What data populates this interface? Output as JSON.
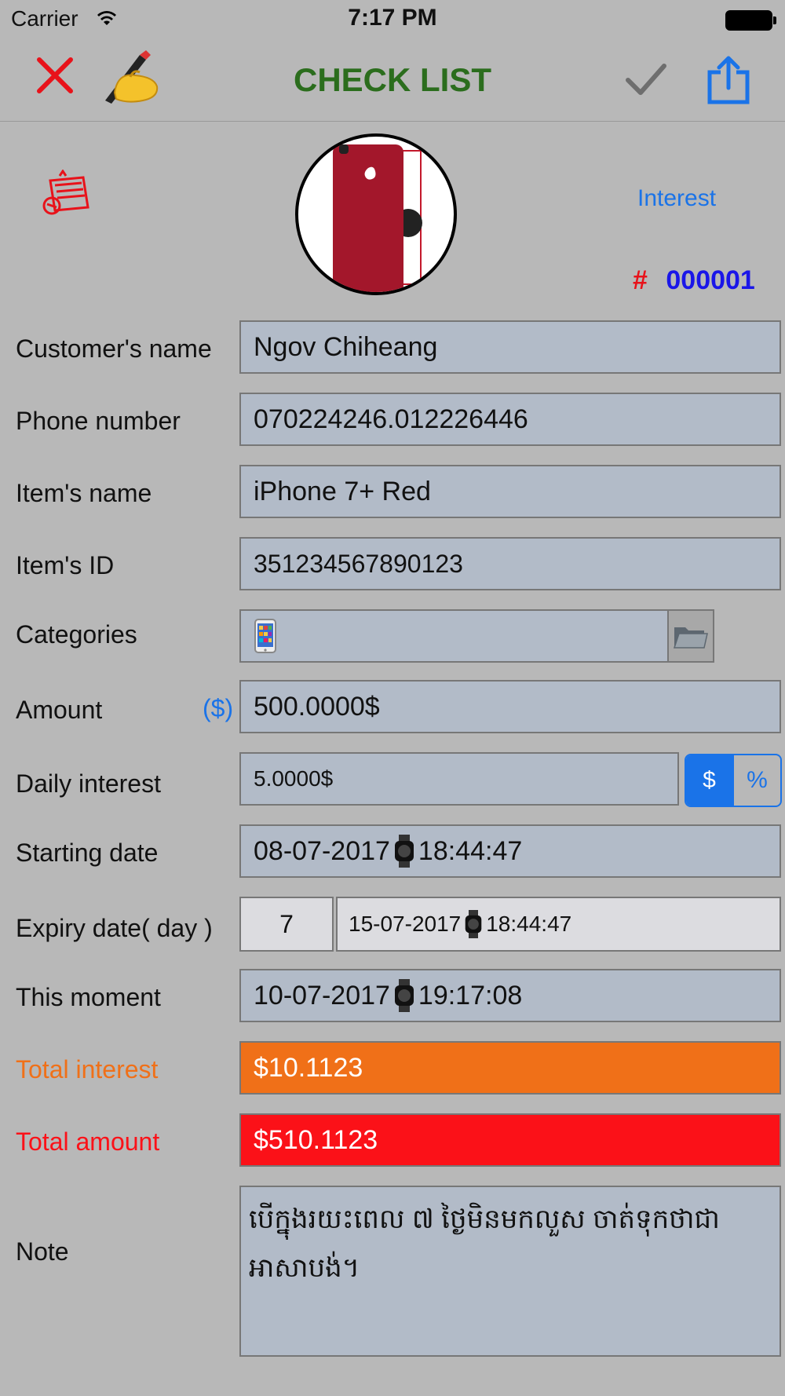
{
  "status": {
    "carrier": "Carrier",
    "time": "7:17 PM"
  },
  "nav": {
    "title": "CHECK LIST"
  },
  "header": {
    "interest_link": "Interest",
    "number_prefix": "#",
    "number": "000001"
  },
  "form": {
    "customer_name": {
      "label": "Customer's name",
      "value": "Ngov Chiheang"
    },
    "phone": {
      "label": "Phone number",
      "value": "070224246.012226446"
    },
    "item_name": {
      "label": "Item's name",
      "value": "iPhone 7+ Red"
    },
    "item_id": {
      "label": "Item's ID",
      "value": "351234567890123"
    },
    "categories": {
      "label": "Categories"
    },
    "amount": {
      "label": "Amount",
      "currency": "($)",
      "value": "500.0000$"
    },
    "daily_interest": {
      "label": "Daily interest",
      "value": "5.0000$",
      "toggle": [
        "$",
        "%"
      ]
    },
    "starting_date": {
      "label": "Starting date",
      "date": "08-07-2017",
      "time": "18:44:47"
    },
    "expiry": {
      "label": "Expiry date( day )",
      "days": "7",
      "date": "15-07-2017",
      "time": "18:44:47"
    },
    "moment": {
      "label": "This moment",
      "date": "10-07-2017",
      "time": "19:17:08"
    },
    "total_interest": {
      "label": "Total interest",
      "value": "$10.1123"
    },
    "total_amount": {
      "label": "Total amount",
      "value": "$510.1123"
    },
    "note": {
      "label": "Note",
      "value": "បើក្នុងរយះពេល ៧ ថ្ងៃមិនមកលួស ចាត់ទុកថាជាអាសាបង់។"
    }
  },
  "colors": {
    "accent": "#1a73e8",
    "title": "#2b6d1d",
    "orange": "#f07018",
    "red": "#fb1118",
    "field": "#b2bbc8"
  }
}
